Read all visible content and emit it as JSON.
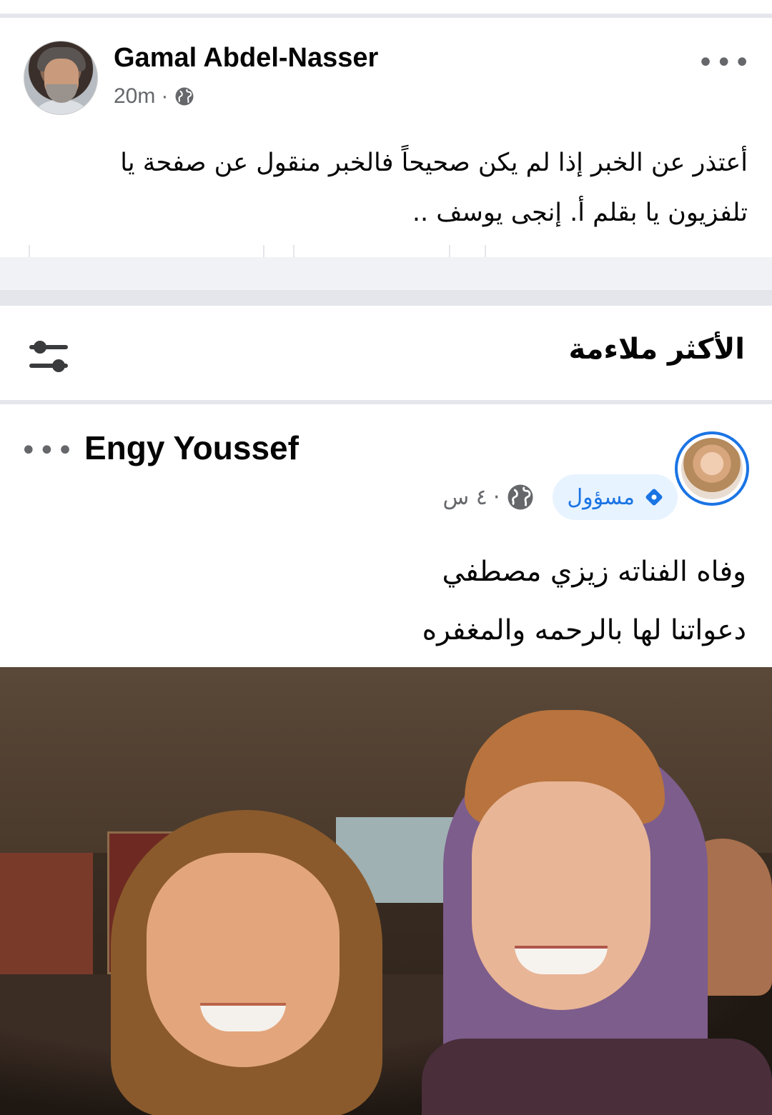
{
  "outer_post": {
    "author": "Gamal Abdel-Nasser",
    "time": "20m",
    "separator": "·",
    "more": "•••",
    "text": "أعتذر عن الخبر إذا لم يكن صحيحاً فالخبر منقول عن صفحة يا تلفزيون يا بقلم أ. إنجى يوسف .."
  },
  "comments_sort": {
    "title": "الأكثر ملاءمة"
  },
  "shared_post": {
    "author": "Engy Youssef",
    "more": "•••",
    "badge": "مسؤول",
    "time": "٤ س",
    "separator": "·",
    "text_line1": "وفاه الفناته زيزي مصطفي",
    "text_line2": "دعواتنا لها بالرحمه والمغفره"
  },
  "colors": {
    "accent": "#1b74e4",
    "badge_bg": "#e7f3ff",
    "secondary_text": "#65676b",
    "divider": "#e4e6eb"
  },
  "icons": [
    "globe-icon",
    "more-icon",
    "filter-icon",
    "admin-diamond-icon"
  ]
}
